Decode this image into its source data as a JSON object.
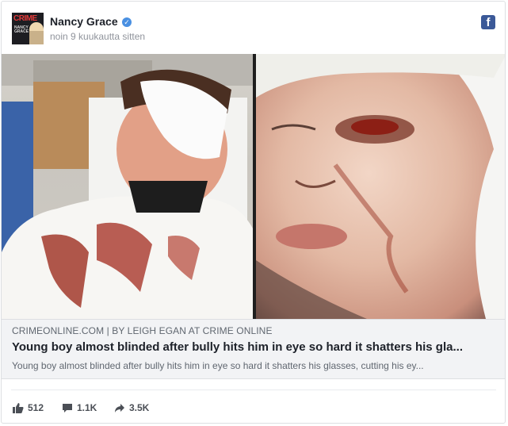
{
  "post": {
    "author": "Nancy Grace",
    "time": "noin 9 kuukautta sitten",
    "avatar_brand": "CRIME",
    "avatar_sub": "NANCY GRACE"
  },
  "link": {
    "source": "CRIMEONLINE.COM | BY LEIGH EGAN AT CRIME ONLINE",
    "headline": "Young boy almost blinded after bully hits him in eye so hard it shatters his gla...",
    "description": "Young boy almost blinded after bully hits him in eye so hard it shatters his glasses, cutting his ey..."
  },
  "stats": {
    "likes": "512",
    "comments": "1.1K",
    "shares": "3.5K"
  },
  "colors": {
    "facebook_blue": "#3b5998",
    "verified_blue": "#4a90e2"
  },
  "icons": {
    "platform": "facebook-icon",
    "like": "thumbs-up-icon",
    "comment": "comment-icon",
    "share": "share-arrow-icon"
  }
}
